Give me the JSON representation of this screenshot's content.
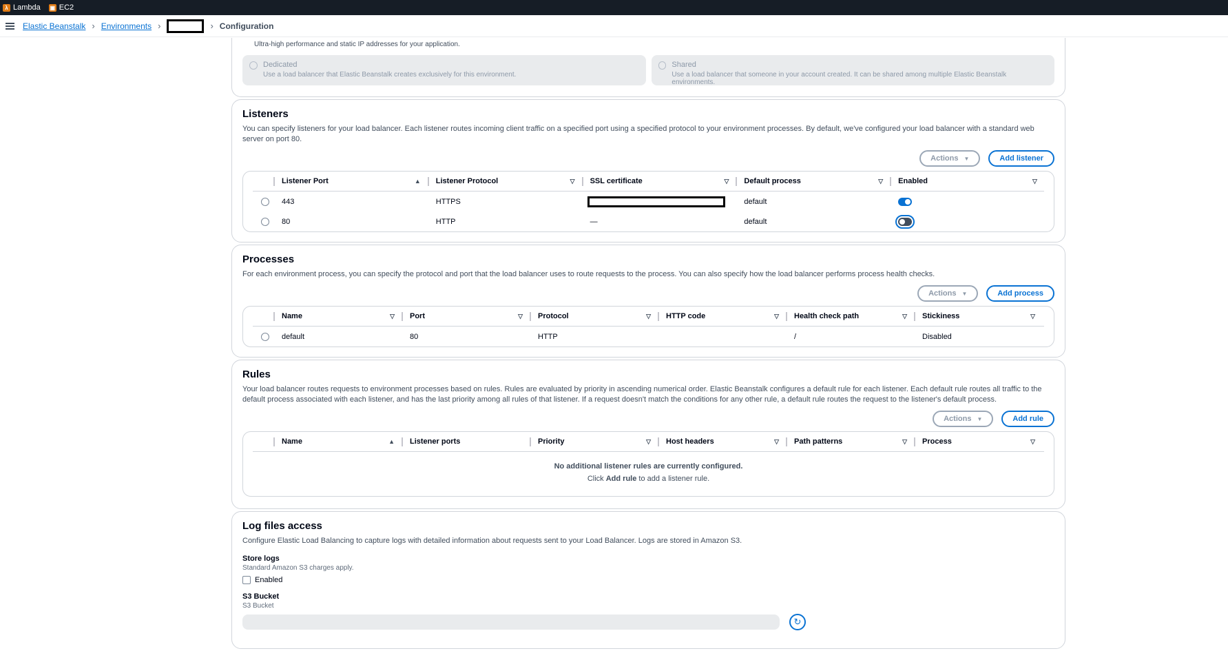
{
  "bookmarks": [
    {
      "label": "Lambda",
      "icon": "lambda-icon"
    },
    {
      "label": "EC2",
      "icon": "ec2-icon"
    }
  ],
  "breadcrumb": {
    "items": [
      "Elastic Beanstalk",
      "Environments"
    ],
    "current": "Configuration"
  },
  "lb_type": {
    "top_desc": "Ultra-high performance and static IP addresses for your application.",
    "options": [
      {
        "title": "Dedicated",
        "desc": "Use a load balancer that Elastic Beanstalk creates exclusively for this environment."
      },
      {
        "title": "Shared",
        "desc": "Use a load balancer that someone in your account created. It can be shared among multiple Elastic Beanstalk environments."
      }
    ]
  },
  "listeners": {
    "title": "Listeners",
    "desc": "You can specify listeners for your load balancer. Each listener routes incoming client traffic on a specified port using a specified protocol to your environment processes. By default, we've configured your load balancer with a standard web server on port 80.",
    "actions_label": "Actions",
    "add_label": "Add listener",
    "columns": [
      "Listener Port",
      "Listener Protocol",
      "SSL certificate",
      "Default process",
      "Enabled"
    ],
    "rows": [
      {
        "port": "443",
        "protocol": "HTTPS",
        "ssl": "",
        "process": "default",
        "enabled": true
      },
      {
        "port": "80",
        "protocol": "HTTP",
        "ssl": "—",
        "process": "default",
        "enabled": false
      }
    ]
  },
  "processes": {
    "title": "Processes",
    "desc": "For each environment process, you can specify the protocol and port that the load balancer uses to route requests to the process. You can also specify how the load balancer performs process health checks.",
    "actions_label": "Actions",
    "add_label": "Add process",
    "columns": [
      "Name",
      "Port",
      "Protocol",
      "HTTP code",
      "Health check path",
      "Stickiness"
    ],
    "rows": [
      {
        "name": "default",
        "port": "80",
        "protocol": "HTTP",
        "http_code": "",
        "health_path": "/",
        "stickiness": "Disabled"
      }
    ]
  },
  "rules": {
    "title": "Rules",
    "desc": "Your load balancer routes requests to environment processes based on rules. Rules are evaluated by priority in ascending numerical order. Elastic Beanstalk configures a default rule for each listener. Each default rule routes all traffic to the default process associated with each listener, and has the last priority among all rules of that listener. If a request doesn't match the conditions for any other rule, a default rule routes the request to the listener's default process.",
    "actions_label": "Actions",
    "add_label": "Add rule",
    "columns": [
      "Name",
      "Listener ports",
      "Priority",
      "Host headers",
      "Path patterns",
      "Process"
    ],
    "empty_title": "No additional listener rules are currently configured.",
    "empty_pre": "Click",
    "empty_bold": "Add rule",
    "empty_post": "to add a listener rule."
  },
  "logs": {
    "title": "Log files access",
    "desc": "Configure Elastic Load Balancing to capture logs with detailed information about requests sent to your Load Balancer. Logs are stored in Amazon S3.",
    "store_label": "Store logs",
    "store_sub": "Standard Amazon S3 charges apply.",
    "enabled_label": "Enabled",
    "bucket_label": "S3 Bucket",
    "bucket_sub": "S3 Bucket"
  }
}
